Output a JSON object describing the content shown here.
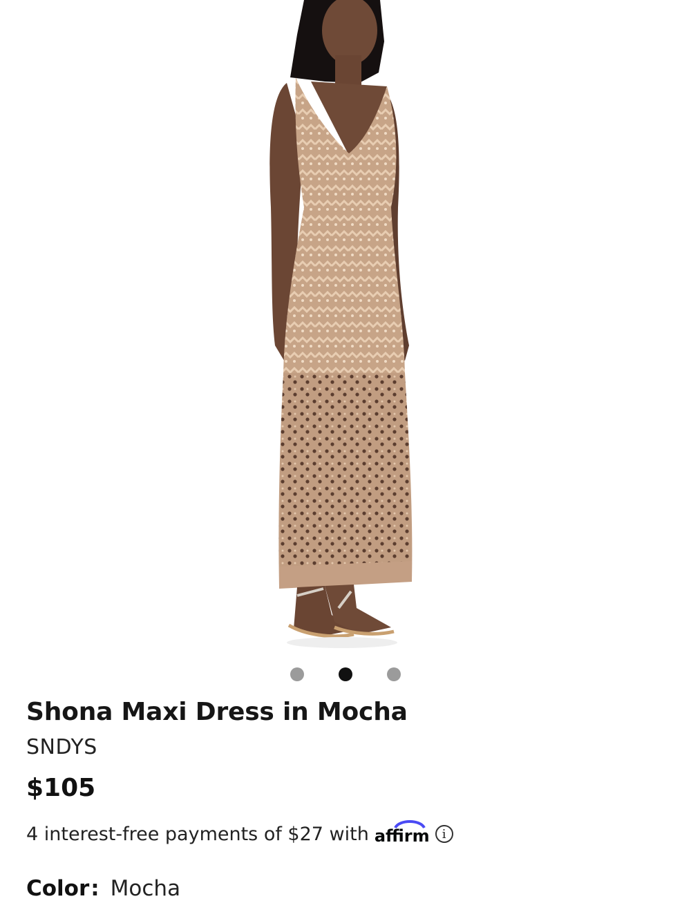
{
  "product": {
    "image_alt": "Model wearing crochet knit maxi dress",
    "title": "Shona Maxi Dress in Mocha",
    "brand": "SNDYS",
    "price": "$105",
    "payments_text": "4 interest-free payments of $27 with",
    "payments_provider": "affirm",
    "color_label": "Color",
    "color_sep": ":",
    "color_value": "Mocha"
  },
  "carousel": {
    "count": 3,
    "active_index": 1
  },
  "colors": {
    "dress": "#c9a688",
    "skin": "#6b4634",
    "accent": "#4a4af4"
  },
  "icons": {
    "info": "info-icon"
  }
}
